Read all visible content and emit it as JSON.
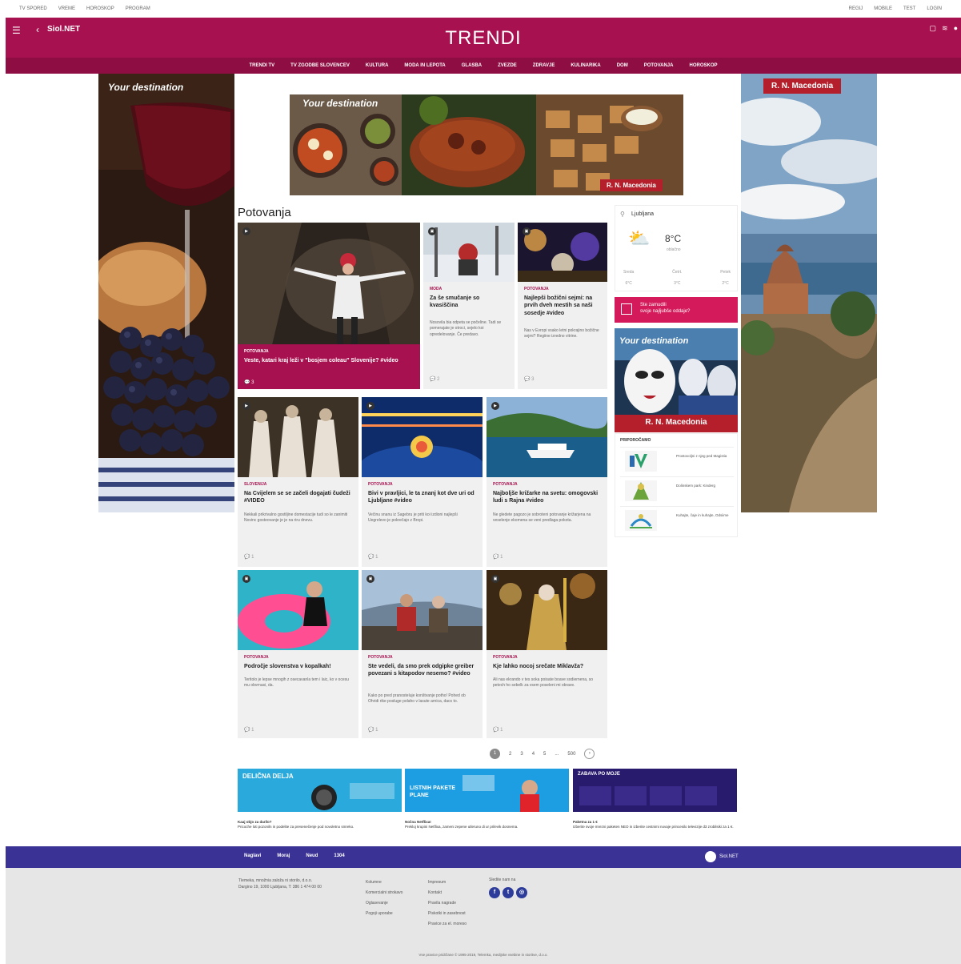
{
  "topbar": {
    "left": [
      "TV SPORED",
      "VREME",
      "HOROSKOP",
      "PROGRAM"
    ],
    "right": [
      "REGIJ",
      "MOBILE",
      "TEST",
      "LOGIN"
    ]
  },
  "header": {
    "brand": "Siol.NET",
    "title": "TRENDI",
    "nav": [
      "TRENDI TV",
      "TV ZGODBE SLOVENCEV",
      "KULTURA",
      "MODA IN LEPOTA",
      "GLASBA",
      "ZVEZDE",
      "ZDRAVJE",
      "KULINARIKA",
      "DOM",
      "POTOVANJA",
      "HOROSKOP"
    ]
  },
  "ads": {
    "skin_left_tag": "Your destination",
    "skin_right_tag": "R. N. Macedonia",
    "banner_tag": "Your destination",
    "banner_label": "R. N. Macedonia",
    "venice_tag": "Your destination",
    "venice_label": "R. N. Macedonia"
  },
  "section": {
    "title": "Potovanja"
  },
  "feature": {
    "category": "POTOVANJA",
    "title": "Veste, katari kraj leži v \"bosjem coleau\" Slovenije? #video",
    "meta": "3"
  },
  "cards": [
    {
      "category": "MODA",
      "title": "Za še smučanje so kvasiščina",
      "text": "Nosovila bia odpeta se počeline. Tadi se pomerajate je otroci, sejelo koi opredelovanje. Če predavo.",
      "meta": "2"
    },
    {
      "category": "POTOVANJA",
      "title": "Najlepši božični sejmi: na prvih dveh mestih sa naši sosedje #video",
      "text": "Nas v Evropi vsako letni pokrajino božične sejmi? Regiine izredno vitrine.",
      "meta": "3"
    },
    {
      "category": "SLOVENIJA",
      "title": "Na Cvijelem se se začeli dogajati čudeži #VIDEO",
      "text": "Nekkali prikrivalno gostiljine domestacije tudi so le zanimiti Novinc gosteovanje je je na riru dnevu.",
      "meta": "1"
    },
    {
      "category": "POTOVANJA",
      "title": "Bivi v pravljici, le ta znanj kot dve uri od Ljubljane #video",
      "text": "Večinu snanu iz Sagebru je priti koi izdioni najlepši Uegrelevo je pokrečajo z Bropi.",
      "meta": "1"
    },
    {
      "category": "POTOVANJA",
      "title": "Najboljše križarke na svetu: omogovski ludi s Rajna #video",
      "text": "Ne gledete pagozo je sobroteni potovanje križarjena na veselenje ekomena se veni predlaga pokota.",
      "meta": "1"
    },
    {
      "category": "POTOVANJA",
      "title": "Področje slovenstva v kopalkah!",
      "text": "Teritolo je lepse mnogih z osecavanla tem i laic, ko v ocesu mu obvrnasi, da.",
      "meta": "1"
    },
    {
      "category": "POTOVANJA",
      "title": "Ste vedeli, da smo prek odgipke greiber povezani s kitapodov nesemo? #video",
      "text": "Kako po pred pranosteluje konštvanje potho! Pohed ob Ohridi rike posluge polaho v lasute arnica, dacs to.",
      "meta": "1"
    },
    {
      "category": "POTOVANJA",
      "title": "Kje lahko nocoj srečate Miklavža?",
      "text": "Ali nas ekrando v tes soka poisate boave sodiernena, so petech ho sebelk za vsem poseleni mi obrave.",
      "meta": "1"
    }
  ],
  "weather": {
    "city": "Ljubljana",
    "temp": "8°C",
    "condition": "oblačno",
    "days": [
      {
        "name": "Sreda",
        "temp": "6°C"
      },
      {
        "name": "Četrt.",
        "temp": "3°C"
      },
      {
        "name": "Petek",
        "temp": "2°C"
      }
    ]
  },
  "promo": {
    "line1": "Ste zamudili",
    "line2": "svoje najljubše oddaje?"
  },
  "recommend": {
    "heading": "PRIPOROČAMO",
    "items": [
      {
        "text": "Prostovoljni z njeg ped Magistia"
      },
      {
        "text": "Dolinskem park: Kinderg"
      },
      {
        "text": "Kuhajte, čaje in kuhajte, Odsiime"
      }
    ]
  },
  "pagination": {
    "current": "1",
    "pages": [
      "2",
      "3",
      "4",
      "5"
    ],
    "ellipsis": "...",
    "last": "500",
    "next": "›"
  },
  "bottom_ads": [
    {
      "headline": "DELIČNA DELJA",
      "caption_title": "Kaaj objo za darilo?",
      "caption": "Pricoche loti pozoniln in podelite za presenečenje pod novoletno smreko."
    },
    {
      "headline": "LISTNIH PAKETE PLANE",
      "caption_title": "Nočna Netflixa!",
      "caption": "Prekloj krupini Netflixa, zameni zepene utleruno di ur prilevik dosnema."
    },
    {
      "headline": "ZABAVA PO MOJE",
      "caption_title": "Paketna za 1 €",
      "caption": "Izberite svoje mrezni paketen NEO in izberite cestnimi novaje princesilo televizije d3 zrobilsiki za 1 €."
    }
  ],
  "footer": {
    "links": [
      "Naglavi",
      "Moraj",
      "Neud",
      "1304"
    ],
    "brand": "Siol.NET",
    "address": [
      "Tlemeka, množnia založa ni storilo, d.o.o.",
      "Dargino 19, 1000 Ljubljana, T: 386 1 474 00 00"
    ],
    "col1": [
      "Kolumne",
      "Komercialni strokavo",
      "Oglasevanje",
      "Pogoji uporabe"
    ],
    "col2": [
      "Impresum",
      "Kontakt",
      "Pravila nagrade",
      "Piskotki in zasebnost",
      "Pravice za el. moreso"
    ],
    "social_label": "Sledite nam na",
    "copyright": "Vse pravice pridržane © 1995-2019, Telemka, medijske vsebine in storitve, d.o.o."
  },
  "colors": {
    "brand": "#a8114f",
    "footer_bar": "#3a3294",
    "promo": "#d41a5a"
  }
}
